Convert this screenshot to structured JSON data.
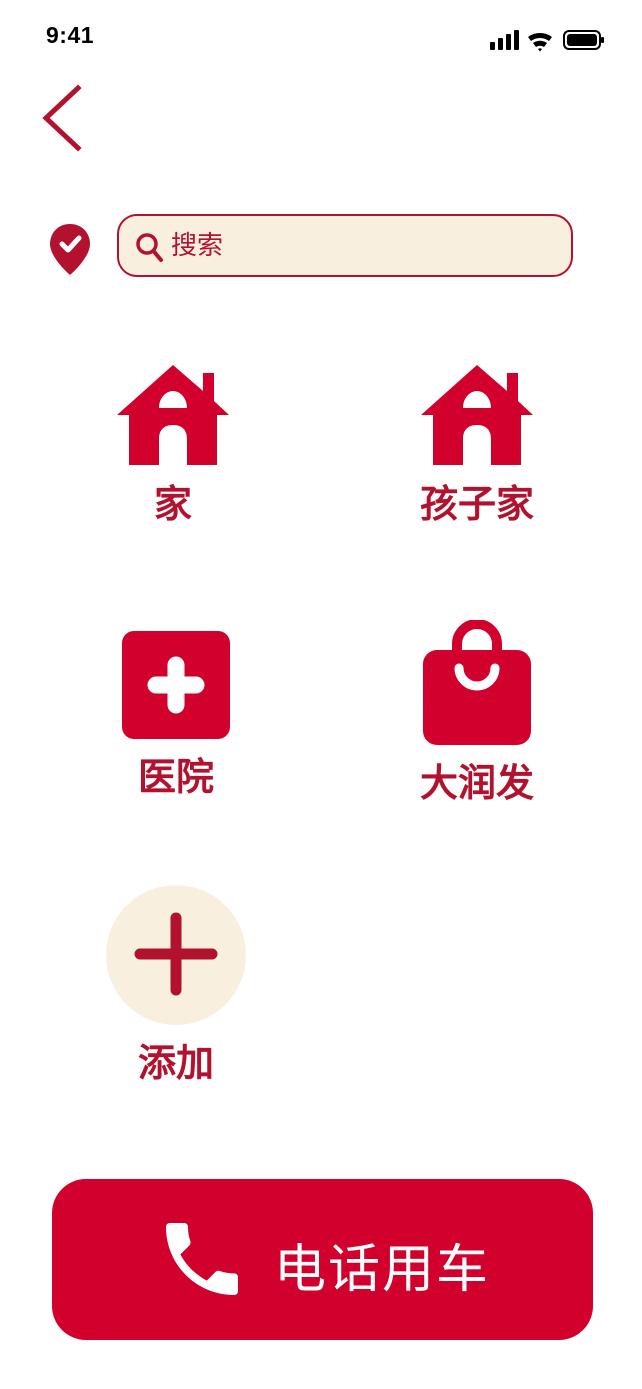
{
  "status_bar": {
    "time": "9:41"
  },
  "search": {
    "placeholder": "搜索"
  },
  "places": [
    {
      "label": "家",
      "icon": "home-icon"
    },
    {
      "label": "孩子家",
      "icon": "home-icon"
    },
    {
      "label": "医院",
      "icon": "hospital-icon"
    },
    {
      "label": "大润发",
      "icon": "shopping-bag-icon"
    },
    {
      "label": "添加",
      "icon": "plus-icon"
    }
  ],
  "call_button": {
    "label": "电话用车",
    "icon": "phone-icon"
  },
  "colors": {
    "accent": "#d1002c",
    "dark_accent": "#b3122f",
    "cream": "#f8efdf"
  }
}
